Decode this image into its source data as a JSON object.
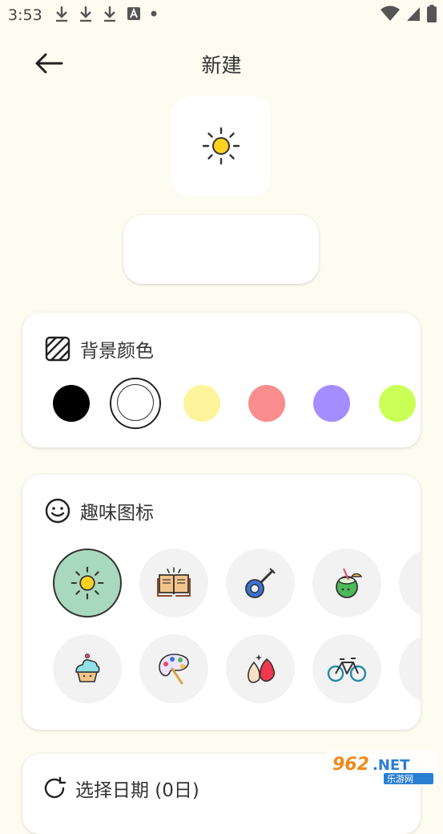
{
  "status": {
    "time": "3:53"
  },
  "header": {
    "title": "新建"
  },
  "preview": {
    "icon": "sun-icon"
  },
  "name_field": {
    "value": "",
    "placeholder": ""
  },
  "background": {
    "title": "背景颜色",
    "colors": [
      "#000000",
      "#ffffff",
      "#fdf49b",
      "#f98c8c",
      "#a38dff",
      "#caff55"
    ],
    "selected_index": 1
  },
  "icons_section": {
    "title": "趣味图标",
    "row1": [
      "sun-icon",
      "book-icon",
      "banjo-icon",
      "coconut-drink-icon",
      "partial-icon"
    ],
    "row2": [
      "cupcake-icon",
      "paint-palette-icon",
      "makeup-sponge-icon",
      "bicycle-icon",
      "partial-icon"
    ],
    "selected": "sun-icon"
  },
  "date_section": {
    "title": "选择日期 (0日)"
  },
  "watermark": {
    "text": "962.NET",
    "sub": "乐游网"
  }
}
